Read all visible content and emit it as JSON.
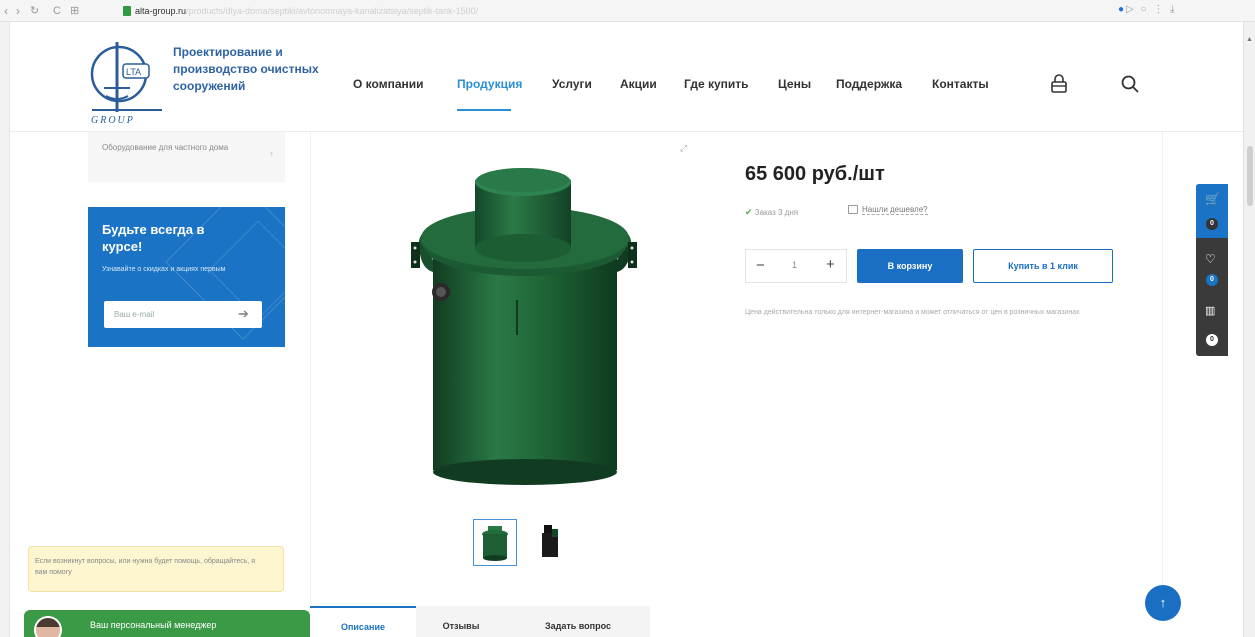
{
  "browser": {
    "url_host": "alta-group.ru",
    "url_path": "/products/dlya-doma/septiki/avtonomnaya-kanalizatsiya/septik-tank-1500/"
  },
  "header": {
    "tagline": "Проектирование и производство очистных сооружений",
    "logo_text": "GROUP",
    "nav": [
      "О компании",
      "Продукция",
      "Услуги",
      "Акции",
      "Где купить",
      "Цены",
      "Поддержка",
      "Контакты"
    ]
  },
  "sidebar": {
    "menu_item": "Оборудование для частного дома",
    "subscribe": {
      "title": "Будьте всегда в курсе!",
      "text": "Узнавайте о скидках и акциях первым",
      "placeholder": "Ваш e-mail"
    }
  },
  "product": {
    "price": "65 600 руб./шт",
    "stock": "Заказ 3 дня",
    "cheaper": "Нашли дешевле?",
    "quantity": "1",
    "cart_button": "В корзину",
    "one_click_button": "Купить в 1 клик",
    "price_note": "Цена действительна только для интернет-магазина и может отличаться от цен в розничных магазинах"
  },
  "side_panel": {
    "cart_count": "0",
    "wishlist_count": "0",
    "compare_count": "0"
  },
  "bottom": {
    "chat_text": "Если возникнут вопросы, или нужна будет помощь, обращайтесь, я вам помогу",
    "manager_label": "Ваш персональный менеджер",
    "tabs": [
      "Описание",
      "Отзывы",
      "Задать вопрос"
    ]
  },
  "colors": {
    "accent": "#1a73c4",
    "product_green": "#1d5e33",
    "chat_green": "#3a9a45"
  }
}
